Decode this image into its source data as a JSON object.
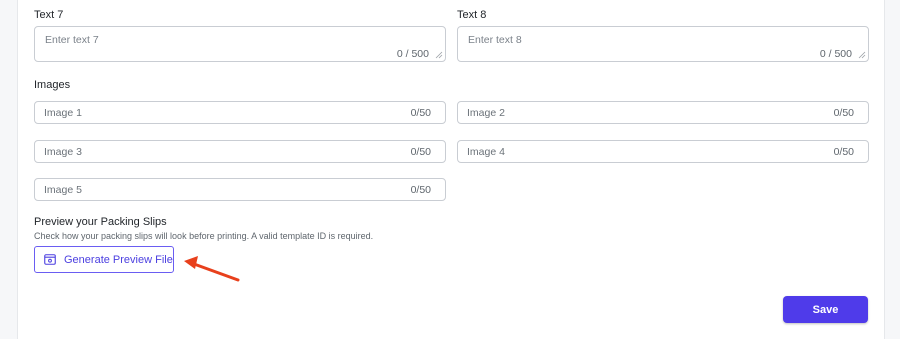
{
  "text_fields": [
    {
      "label": "Text 7",
      "placeholder": "Enter text 7",
      "counter": "0 / 500"
    },
    {
      "label": "Text 8",
      "placeholder": "Enter text 8",
      "counter": "0 / 500"
    }
  ],
  "images": {
    "section_label": "Images",
    "fields": [
      {
        "placeholder": "Image 1",
        "counter": "0/50"
      },
      {
        "placeholder": "Image 2",
        "counter": "0/50"
      },
      {
        "placeholder": "Image 3",
        "counter": "0/50"
      },
      {
        "placeholder": "Image 4",
        "counter": "0/50"
      },
      {
        "placeholder": "Image 5",
        "counter": "0/50"
      }
    ]
  },
  "preview": {
    "title": "Preview your Packing Slips",
    "help": "Check how your packing slips will look before printing. A valid template ID is required.",
    "button_label": "Generate Preview File",
    "button_icon": "browser-window-icon"
  },
  "annotation": {
    "icon": "red-arrow-icon",
    "color": "#e8401c"
  },
  "actions": {
    "save_label": "Save"
  },
  "colors": {
    "accent": "#4f3bea",
    "border": "#c9cdd3"
  }
}
